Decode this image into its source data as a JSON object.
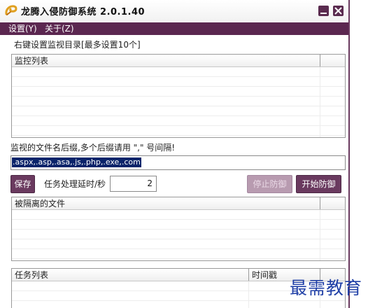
{
  "window": {
    "title": "龙腾入侵防御系统 2.0.1.40",
    "icon": "dragon-logo-icon",
    "accent_color": "#5b2750"
  },
  "menu": {
    "items": [
      {
        "label": "设置(Y)"
      },
      {
        "label": "关于(Z)"
      }
    ]
  },
  "monitor_dirs": {
    "hint": "右键设置监视目录[最多设置10个]",
    "column": "监控列表"
  },
  "extensions": {
    "label": "监视的文件名后缀,多个后缀请用 \",\" 号间隔!",
    "value": ".aspx,.asp,.asa,.js,.php,.exe,.com"
  },
  "controls": {
    "save_label": "保存",
    "delay_label": "任务处理延时/秒",
    "delay_value": "2",
    "stop_label": "停止防御",
    "start_label": "开始防御"
  },
  "quarantine": {
    "column": "被隔离的文件"
  },
  "tasks": {
    "columns": [
      "任务列表",
      "时间戳"
    ]
  },
  "watermark": "最需教育"
}
